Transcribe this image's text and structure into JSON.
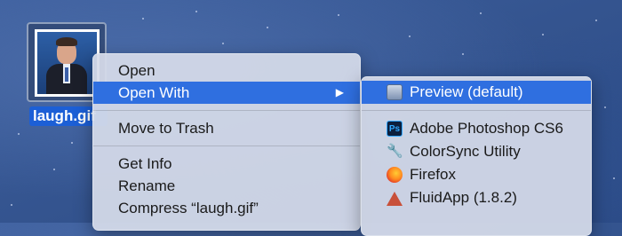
{
  "desktop": {
    "file_name": "laugh.gif"
  },
  "context_menu": {
    "items": [
      {
        "label": "Open"
      },
      {
        "label": "Open With",
        "has_submenu": true,
        "submenu_arrow": "▶"
      },
      {
        "label": "Move to Trash"
      },
      {
        "label": "Get Info"
      },
      {
        "label": "Rename"
      },
      {
        "label": "Compress “laugh.gif”"
      }
    ]
  },
  "open_with_submenu": {
    "items": [
      {
        "label": "Preview (default)",
        "icon": "preview-icon"
      },
      {
        "label": "Adobe Photoshop CS6",
        "icon": "photoshop-icon",
        "icon_text": "Ps"
      },
      {
        "label": "ColorSync Utility",
        "icon": "colorsync-icon",
        "icon_text": "🔧"
      },
      {
        "label": "Firefox",
        "icon": "firefox-icon"
      },
      {
        "label": "FluidApp (1.8.2)",
        "icon": "fluidapp-icon"
      }
    ]
  },
  "colors": {
    "highlight": "#2f6fe0",
    "menu_bg": "#d6dbea",
    "desktop_bg": "#34548f"
  }
}
